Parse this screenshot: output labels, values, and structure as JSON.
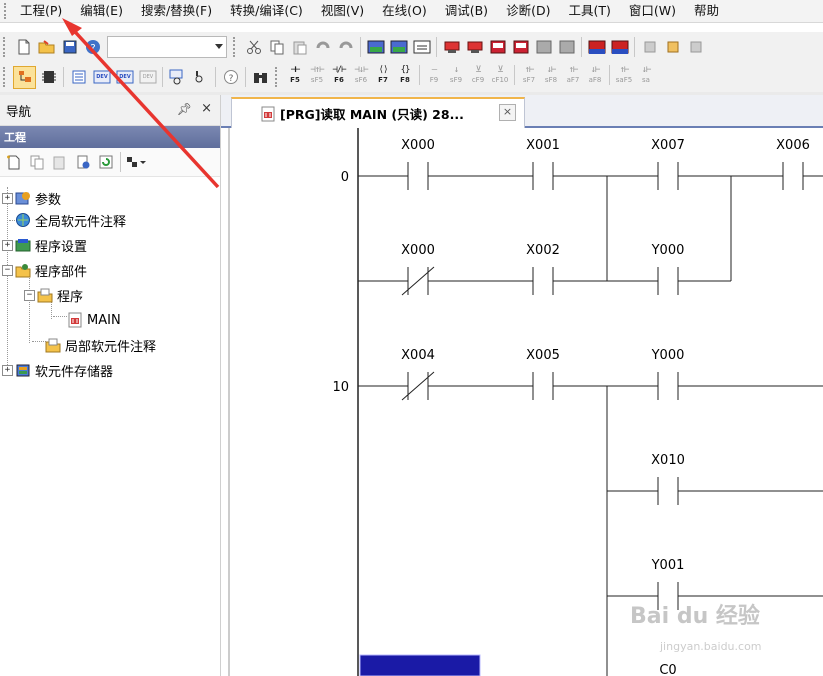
{
  "menu": {
    "items": [
      {
        "label": "工程(P)"
      },
      {
        "label": "编辑(E)"
      },
      {
        "label": "搜索/替换(F)"
      },
      {
        "label": "转换/编译(C)"
      },
      {
        "label": "视图(V)"
      },
      {
        "label": "在线(O)"
      },
      {
        "label": "调试(B)"
      },
      {
        "label": "诊断(D)"
      },
      {
        "label": "工具(T)"
      },
      {
        "label": "窗口(W)"
      },
      {
        "label": "帮助"
      }
    ]
  },
  "toolbar2": {
    "keys": [
      {
        "sym": "⊣⊢",
        "label": "F5"
      },
      {
        "sym": "⊣↑⊢",
        "label": "sF5",
        "dim": true
      },
      {
        "sym": "⊣/⊢",
        "label": "F6"
      },
      {
        "sym": "⊣↓⊢",
        "label": "sF6",
        "dim": true
      },
      {
        "sym": "⟨⟩",
        "label": "F7"
      },
      {
        "sym": "{}",
        "label": "F8"
      },
      {
        "sym": "—",
        "label": "F9",
        "dim": true
      },
      {
        "sym": "↓",
        "label": "sF9",
        "dim": true
      },
      {
        "sym": "⊻",
        "label": "cF9",
        "dim": true
      },
      {
        "sym": "⊻",
        "label": "cF10",
        "dim": true
      },
      {
        "sym": "↑⊢",
        "label": "sF7",
        "dim": true
      },
      {
        "sym": "↓⊢",
        "label": "sF8",
        "dim": true
      },
      {
        "sym": "↑⊢",
        "label": "aF7",
        "dim": true
      },
      {
        "sym": "↓⊢",
        "label": "aF8",
        "dim": true
      },
      {
        "sym": "↑⊢",
        "label": "saF5",
        "dim": true
      },
      {
        "sym": "↓⊢",
        "label": "sa",
        "dim": true
      }
    ]
  },
  "nav": {
    "title": "导航",
    "pin": "ᵖ",
    "close": "×",
    "section": "工程",
    "tree": [
      {
        "label": "参数",
        "expander": "+"
      },
      {
        "label": "全局软元件注释"
      },
      {
        "label": "程序设置",
        "expander": "+"
      },
      {
        "label": "程序部件",
        "expander": "−"
      },
      {
        "label": "程序",
        "expander": "−"
      },
      {
        "label": "MAIN"
      },
      {
        "label": "局部软元件注释"
      },
      {
        "label": "软元件存储器",
        "expander": "+"
      }
    ]
  },
  "editor": {
    "tab_label": "[PRG]读取 MAIN (只读) 28...",
    "tab_close": "×"
  },
  "ladder": {
    "step_numbers": [
      "0",
      "10"
    ],
    "contact_labels": [
      "X000",
      "X001",
      "X007",
      "X006",
      "X000",
      "X002",
      "Y000",
      "X004",
      "X005",
      "Y000",
      "X010",
      "Y001",
      "C0"
    ]
  },
  "watermark": {
    "text": "Bai du 经验",
    "url": "jingyan.baidu.com"
  },
  "colors": {
    "arrow": "#e8352f",
    "nav_section": "#6a78a8",
    "tab_accent": "#f0b54b",
    "selection_block": "#1a1aa6"
  }
}
